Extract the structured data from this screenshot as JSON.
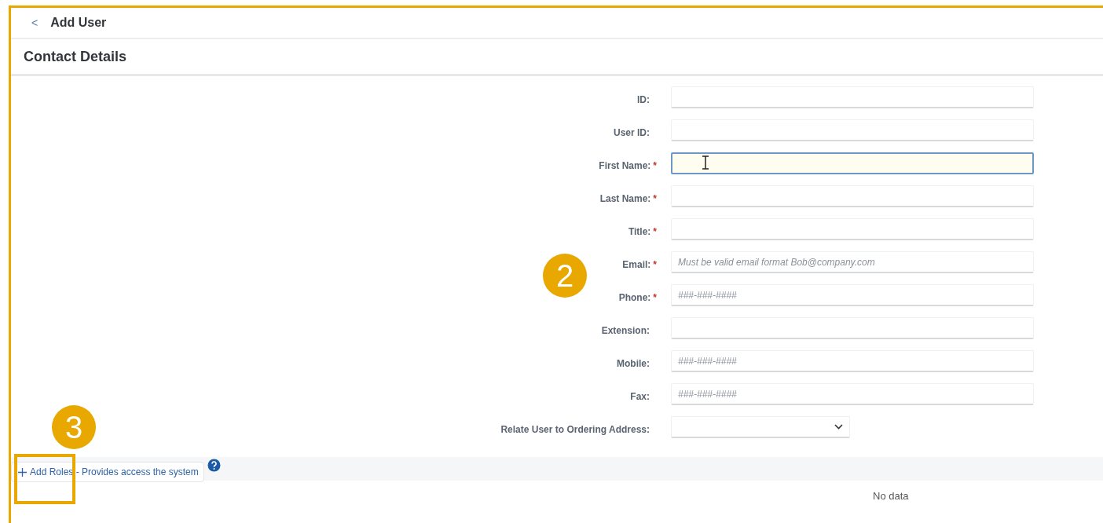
{
  "header": {
    "back": "<",
    "title": "Add User"
  },
  "section": {
    "title": "Contact Details"
  },
  "fields": [
    {
      "kind": "text",
      "label": "ID:",
      "focused": false
    },
    {
      "kind": "text",
      "label": "User ID:",
      "focused": false
    },
    {
      "kind": "text",
      "label": "First Name:",
      "required_mark": "*",
      "focused": true
    },
    {
      "kind": "text",
      "label": "Last Name:",
      "required_mark": "*",
      "focused": false
    },
    {
      "kind": "text",
      "label": "Title:",
      "required_mark": "*",
      "focused": false
    },
    {
      "kind": "text",
      "label": "Email:",
      "required_mark": "*",
      "focused": false,
      "placeholder": "Must be valid email format Bob@company.com"
    },
    {
      "kind": "text",
      "label": "Phone:",
      "required_mark": "*",
      "focused": false,
      "placeholder": "###-###-####"
    },
    {
      "kind": "text",
      "label": "Extension:",
      "focused": false
    },
    {
      "kind": "text",
      "label": "Mobile:",
      "focused": false,
      "placeholder": "###-###-####"
    },
    {
      "kind": "text",
      "label": "Fax:",
      "focused": false,
      "placeholder": "###-###-####"
    },
    {
      "kind": "select",
      "label": "Relate User to Ordering Address:",
      "focused": false
    }
  ],
  "roles": {
    "button": "Add Roles - Provides access the system",
    "empty": "No data"
  },
  "callouts": [
    {
      "label": "2"
    },
    {
      "label": "3"
    }
  ]
}
